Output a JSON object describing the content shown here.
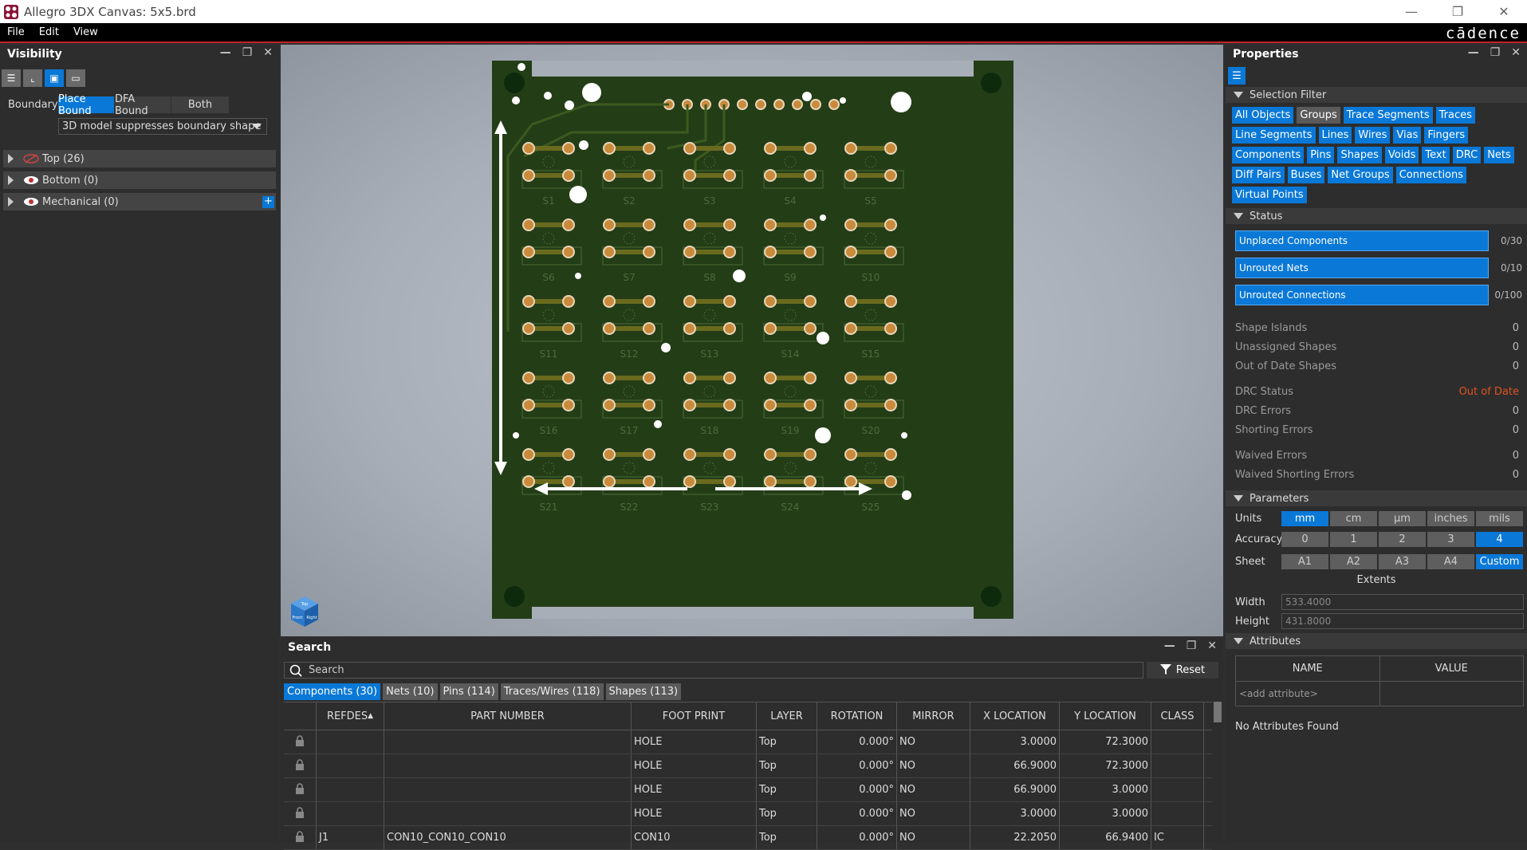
{
  "window": {
    "title": "Allegro 3DX Canvas: 5x5.brd",
    "controls": [
      "minimize-icon",
      "restore-icon",
      "close-icon"
    ]
  },
  "menu": {
    "items": [
      "File",
      "Edit",
      "View"
    ],
    "brand": "cādence"
  },
  "visibility": {
    "title": "Visibility",
    "boundary_label": "Boundary",
    "boundary_options": [
      "Place Bound",
      "DFA Bound",
      "Both"
    ],
    "boundary_selected": "Place Bound",
    "boundary_dropdown": "3D model suppresses boundary shape",
    "layers": [
      {
        "label": "Top (26)",
        "icon": "eye-hidden-icon"
      },
      {
        "label": "Bottom (0)",
        "icon": "eye-icon"
      },
      {
        "label": "Mechanical (0)",
        "icon": "eye-icon"
      }
    ]
  },
  "properties": {
    "title": "Properties",
    "selection_filter": {
      "heading": "Selection Filter",
      "chips": [
        {
          "label": "All Objects",
          "on": true
        },
        {
          "label": "Groups",
          "on": false
        },
        {
          "label": "Trace Segments",
          "on": true
        },
        {
          "label": "Traces",
          "on": true
        },
        {
          "label": "Line Segments",
          "on": true
        },
        {
          "label": "Lines",
          "on": true
        },
        {
          "label": "Wires",
          "on": true
        },
        {
          "label": "Vias",
          "on": true
        },
        {
          "label": "Fingers",
          "on": true
        },
        {
          "label": "Components",
          "on": true
        },
        {
          "label": "Pins",
          "on": true
        },
        {
          "label": "Shapes",
          "on": true
        },
        {
          "label": "Voids",
          "on": true
        },
        {
          "label": "Text",
          "on": true
        },
        {
          "label": "DRC",
          "on": true
        },
        {
          "label": "Nets",
          "on": true
        },
        {
          "label": "Diff Pairs",
          "on": true
        },
        {
          "label": "Buses",
          "on": true
        },
        {
          "label": "Net Groups",
          "on": true
        },
        {
          "label": "Connections",
          "on": true
        },
        {
          "label": "Virtual Points",
          "on": true
        }
      ]
    },
    "status": {
      "heading": "Status",
      "bars": [
        {
          "label": "Unplaced Components",
          "value": "0/30"
        },
        {
          "label": "Unrouted Nets",
          "value": "0/10"
        },
        {
          "label": "Unrouted Connections",
          "value": "0/100"
        }
      ],
      "group1": [
        {
          "label": "Shape Islands",
          "value": "0"
        },
        {
          "label": "Unassigned Shapes",
          "value": "0"
        },
        {
          "label": "Out of Date Shapes",
          "value": "0"
        }
      ],
      "group2": [
        {
          "label": "DRC Status",
          "value": "Out of Date"
        },
        {
          "label": "DRC Errors",
          "value": "0"
        },
        {
          "label": "Shorting Errors",
          "value": "0"
        }
      ],
      "group3": [
        {
          "label": "Waived Errors",
          "value": "0"
        },
        {
          "label": "Waived Shorting Errors",
          "value": "0"
        }
      ],
      "drc_status_color": "#e0531f"
    },
    "parameters": {
      "heading": "Parameters",
      "units_label": "Units",
      "units": [
        "mm",
        "cm",
        "µm",
        "inches",
        "mils"
      ],
      "units_selected": "mm",
      "accuracy_label": "Accuracy",
      "accuracy": [
        "0",
        "1",
        "2",
        "3",
        "4"
      ],
      "accuracy_selected": "4",
      "sheet_label": "Sheet",
      "sheets": [
        "A1",
        "A2",
        "A3",
        "A4",
        "Custom"
      ],
      "sheet_selected": "Custom",
      "extents_label": "Extents",
      "width_label": "Width",
      "width_value": "533.4000",
      "height_label": "Height",
      "height_value": "431.8000"
    },
    "attributes": {
      "heading": "Attributes",
      "col_name": "NAME",
      "col_value": "VALUE",
      "add_placeholder": "<add attribute>",
      "empty_text": "No Attributes Found"
    }
  },
  "search": {
    "title": "Search",
    "placeholder": "Search",
    "reset_label": "Reset",
    "tabs": [
      {
        "label": "Components (30)",
        "active": true
      },
      {
        "label": "Nets (10)",
        "active": false
      },
      {
        "label": "Pins (114)",
        "active": false
      },
      {
        "label": "Traces/Wires (118)",
        "active": false
      },
      {
        "label": "Shapes (113)",
        "active": false
      }
    ],
    "columns": [
      "",
      "REFDES",
      "PART NUMBER",
      "FOOT PRINT",
      "LAYER",
      "ROTATION",
      "MIRROR",
      "X LOCATION",
      "Y LOCATION",
      "CLASS"
    ],
    "rows": [
      [
        "",
        "",
        "",
        "HOLE",
        "Top",
        "0.000°",
        "NO",
        "3.0000",
        "72.3000",
        ""
      ],
      [
        "",
        "",
        "",
        "HOLE",
        "Top",
        "0.000°",
        "NO",
        "66.9000",
        "72.3000",
        ""
      ],
      [
        "",
        "",
        "",
        "HOLE",
        "Top",
        "0.000°",
        "NO",
        "66.9000",
        "3.0000",
        ""
      ],
      [
        "",
        "",
        "",
        "HOLE",
        "Top",
        "0.000°",
        "NO",
        "3.0000",
        "3.0000",
        ""
      ],
      [
        "",
        "J1",
        "CON10_CON10_CON10",
        "CON10",
        "Top",
        "0.000°",
        "NO",
        "22.2050",
        "66.9400",
        "IC"
      ]
    ]
  },
  "board": {
    "silk_labels": [
      "S1",
      "S2",
      "S3",
      "S4",
      "S5",
      "S6",
      "S7",
      "S8",
      "S9",
      "S10",
      "S11",
      "S12",
      "S13",
      "S14",
      "S15",
      "S16",
      "S17",
      "S18",
      "S19",
      "S20",
      "S21",
      "S22",
      "S23",
      "S24",
      "S25"
    ],
    "view_cube_faces": [
      "Top",
      "Front",
      "Right"
    ]
  }
}
